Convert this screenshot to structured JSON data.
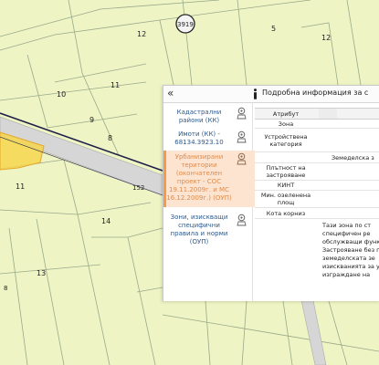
{
  "map": {
    "parcel_labels": [
      "12",
      "10",
      "11",
      "9",
      "8",
      "11",
      "152",
      "14",
      "13",
      "3919",
      "5",
      "12",
      "8"
    ],
    "colors": {
      "background": "#eef4c4",
      "parcel_line": "#9aa98a",
      "road": "#c9c9c9",
      "highlight_fill": "#f6d64e",
      "highlight_stroke": "#e3a82a",
      "selected_outline": "#1f1f4a"
    }
  },
  "popup": {
    "collapse_label": "«",
    "title": "Подробна информация за с",
    "layers": [
      {
        "label": "Кадастрални райони (КК)",
        "icon": "map-pin-icon"
      },
      {
        "label": "Имоти (КК) - 68134.3923.10",
        "icon": "map-pin-icon"
      },
      {
        "label": "Урбанизирани територии (окончателен проект - СОС 19.11.2009г. и МС 16.12.2009г.) (ОУП)",
        "icon": "map-pin-icon"
      },
      {
        "label": "Зони, изискващи специфични правила и норми (ОУП)",
        "icon": "map-pin-icon"
      }
    ],
    "table": {
      "header_key": "Атрибут",
      "rows": [
        {
          "key": "Зона",
          "value": ""
        },
        {
          "key": "Устройствена категория",
          "value": ""
        },
        {
          "key": "",
          "value": "Земеделска з"
        },
        {
          "key": "Плътност на застрояване",
          "value": ""
        },
        {
          "key": "КИНТ",
          "value": ""
        },
        {
          "key": "Мин. озеленена площ",
          "value": ""
        },
        {
          "key": "Кота корниз",
          "value": ""
        },
        {
          "key": "",
          "value": "Тази зона по ст специфичен ре обслужващи функ Застрояване без п земеделската зе изискванията за уст се : изграждане на"
        }
      ]
    }
  }
}
